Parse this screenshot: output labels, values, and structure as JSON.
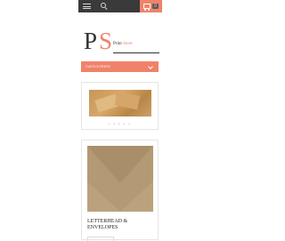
{
  "header": {
    "menu_icon": "hamburger-icon",
    "search_icon": "search-icon",
    "cart_icon": "cart-icon",
    "cart_count": "0",
    "bar_color": "#3a3a3a",
    "accent_color": "#f0826a"
  },
  "logo": {
    "letter_p": "P",
    "letter_s": "S",
    "word_print": "Print",
    "word_store": "Store"
  },
  "categories": {
    "label": "CATEGORIES",
    "icon": "chevron-down-icon"
  },
  "products": [
    {
      "title": "",
      "dots": "● ● ● ● ●"
    },
    {
      "title": "LETTERHEAD & ENVELOPES"
    }
  ]
}
